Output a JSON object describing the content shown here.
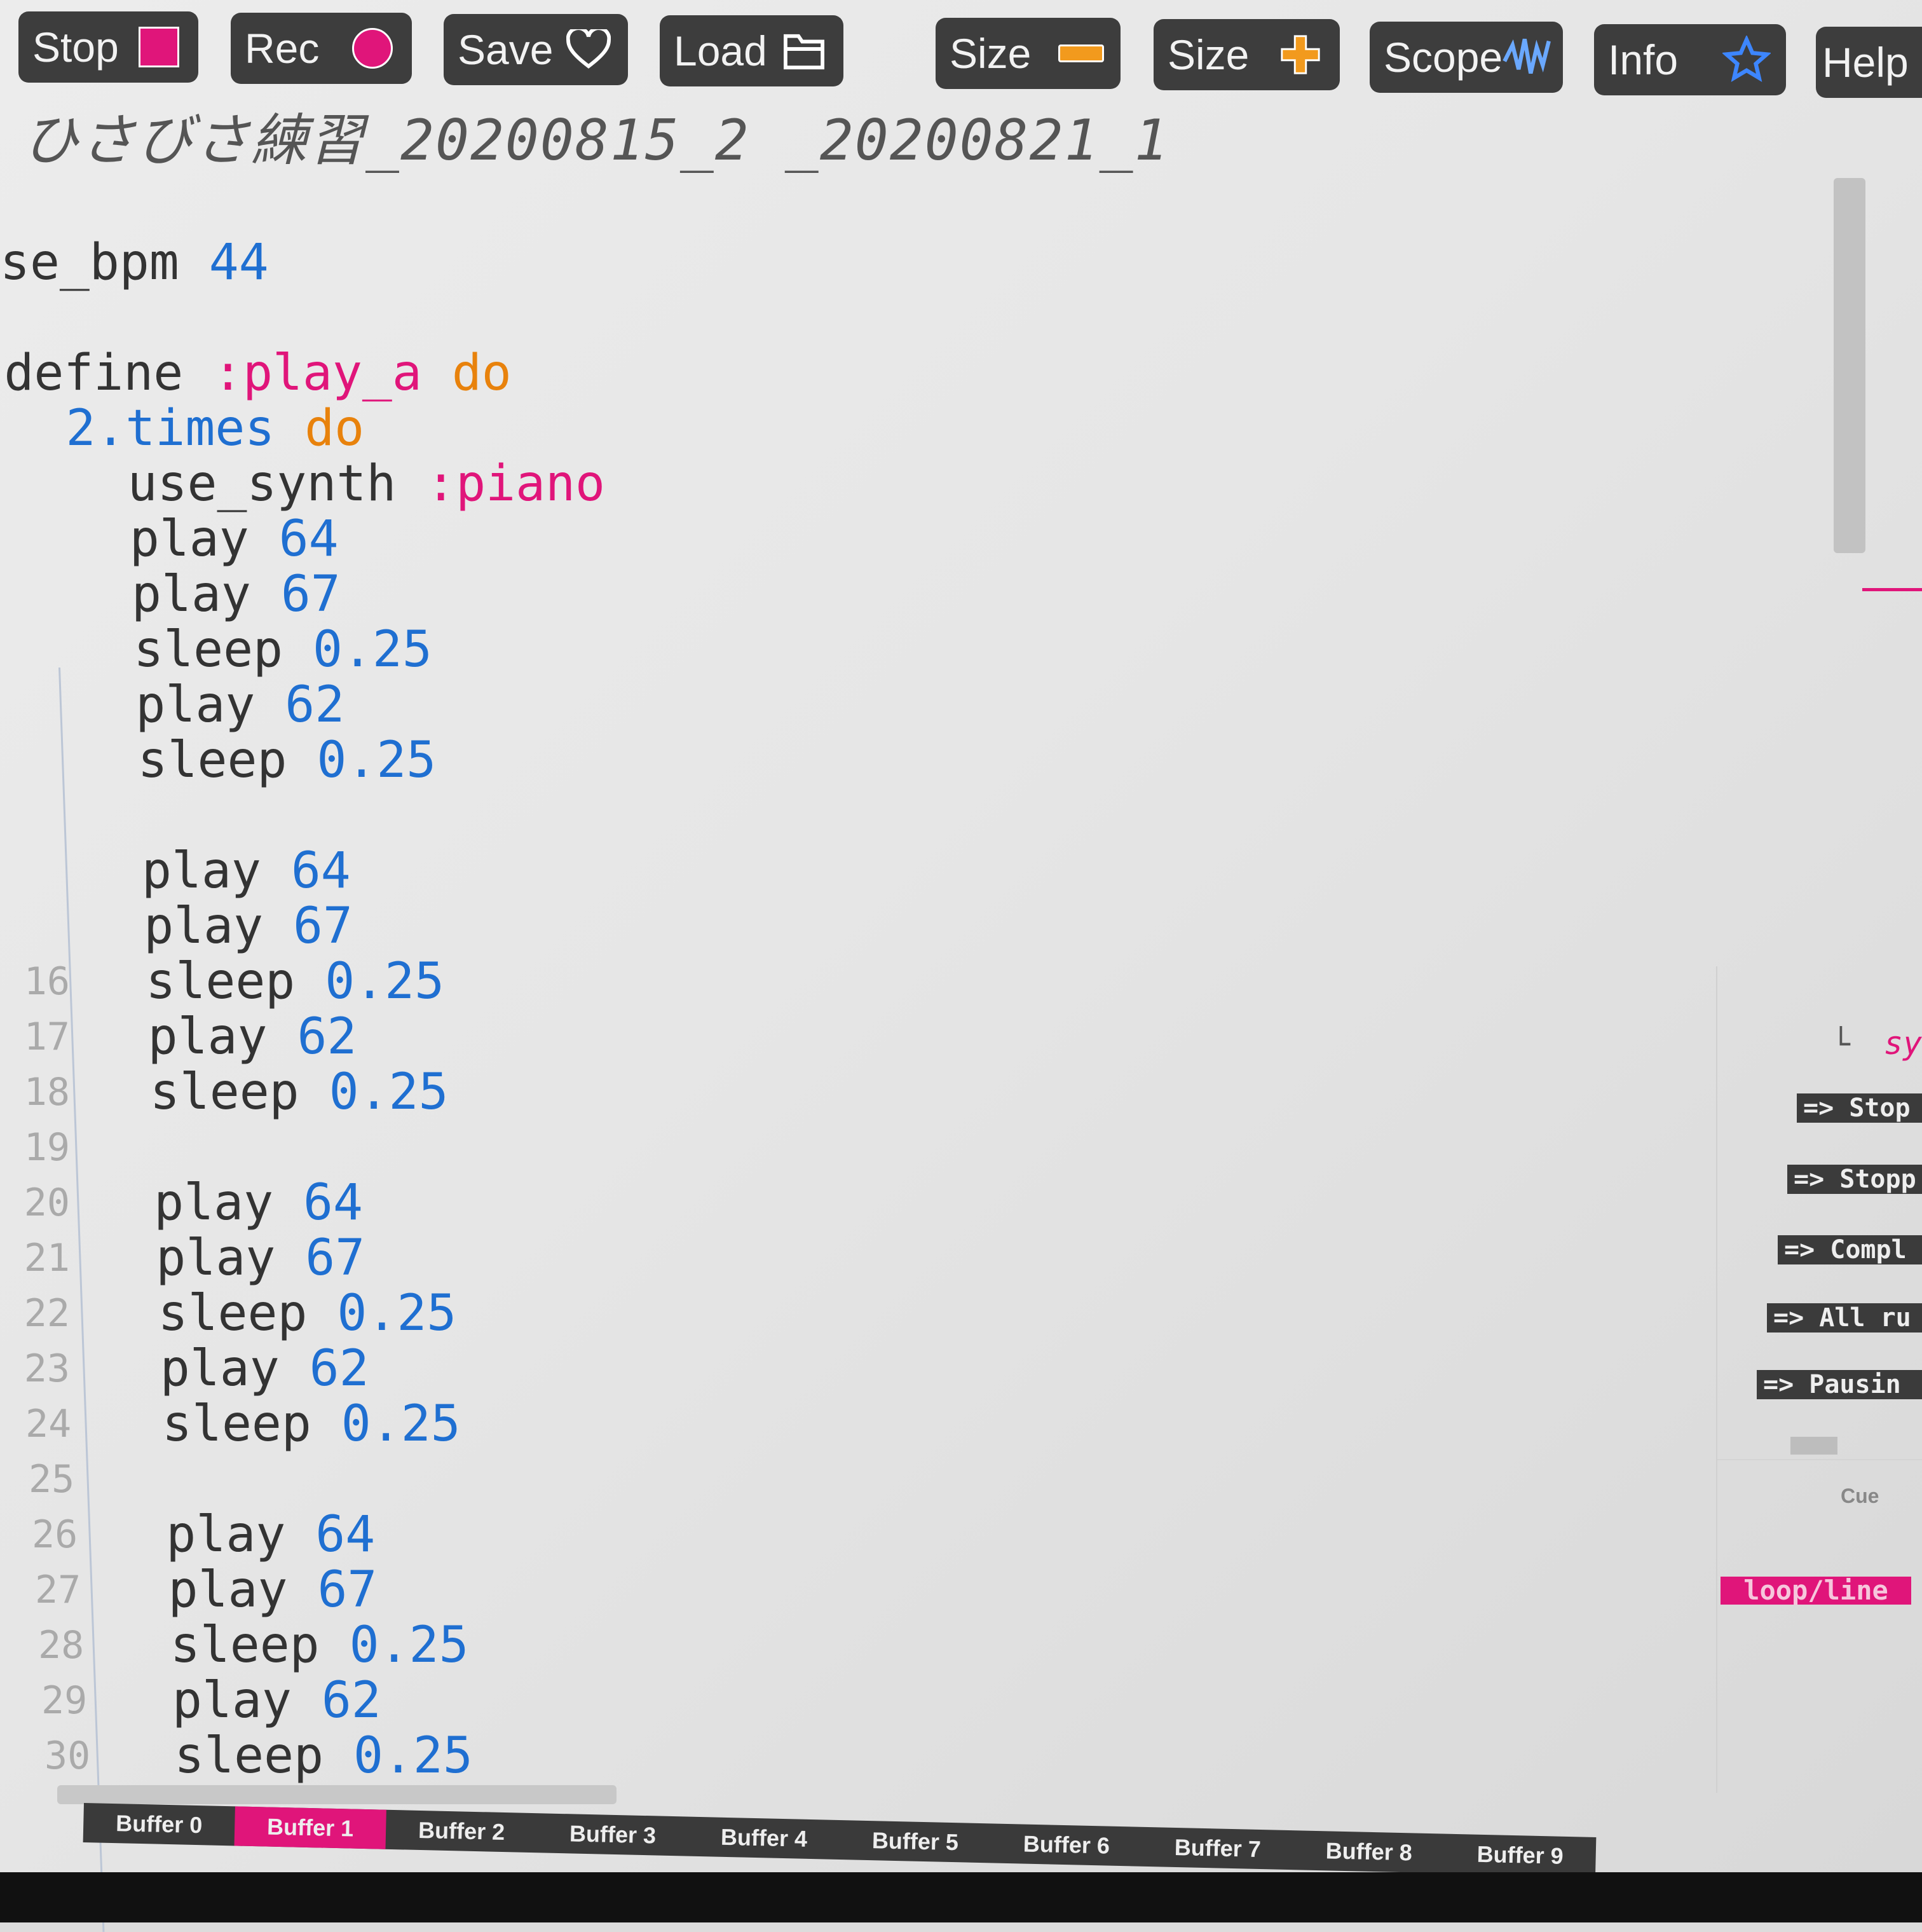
{
  "toolbar": {
    "buttons": [
      {
        "label": "Stop",
        "icon": "stop-square-icon"
      },
      {
        "label": "Rec",
        "icon": "record-circle-icon"
      },
      {
        "label": "Save",
        "icon": "heart-icon"
      },
      {
        "label": "Load",
        "icon": "folder-icon"
      },
      {
        "label": "Size",
        "icon": "minus-icon"
      },
      {
        "label": "Size",
        "icon": "plus-icon"
      },
      {
        "label": "Scope",
        "icon": "waveform-icon"
      },
      {
        "label": "Info",
        "icon": "star-icon"
      },
      {
        "label": "Help",
        "icon": ""
      }
    ]
  },
  "colors": {
    "accent": "#e0157a",
    "number": "#1f6fd1",
    "keyword": "#e8820c",
    "toolbar": "#3d3d3d",
    "plus_icon": "#f29a1d"
  },
  "editor": {
    "title": "ひさびさ練習_20200815_2 _20200821_1",
    "line_numbers": [
      "16",
      "17",
      "18",
      "19",
      "20",
      "21",
      "22",
      "23",
      "24",
      "25",
      "26",
      "27",
      "28",
      "29",
      "30"
    ],
    "lines": [
      [
        {
          "t": "se_bpm ",
          "c": "txt"
        },
        {
          "t": "44",
          "c": "num"
        }
      ],
      [],
      [
        {
          "t": "define ",
          "c": "txt"
        },
        {
          "t": ":play_a ",
          "c": "sym"
        },
        {
          "t": "do",
          "c": "kw"
        }
      ],
      [
        {
          "t": "  2.times ",
          "c": "num"
        },
        {
          "t": "do",
          "c": "kw"
        }
      ],
      [
        {
          "t": "    use_synth ",
          "c": "txt"
        },
        {
          "t": ":piano",
          "c": "sym"
        }
      ],
      [
        {
          "t": "    play ",
          "c": "txt"
        },
        {
          "t": "64",
          "c": "num"
        }
      ],
      [
        {
          "t": "    play ",
          "c": "txt"
        },
        {
          "t": "67",
          "c": "num"
        }
      ],
      [
        {
          "t": "    sleep ",
          "c": "txt"
        },
        {
          "t": "0.25",
          "c": "num"
        }
      ],
      [
        {
          "t": "    play ",
          "c": "txt"
        },
        {
          "t": "62",
          "c": "num"
        }
      ],
      [
        {
          "t": "    sleep ",
          "c": "txt"
        },
        {
          "t": "0.25",
          "c": "num"
        }
      ],
      [],
      [
        {
          "t": "    play ",
          "c": "txt"
        },
        {
          "t": "64",
          "c": "num"
        }
      ],
      [
        {
          "t": "    play ",
          "c": "txt"
        },
        {
          "t": "67",
          "c": "num"
        }
      ],
      [
        {
          "t": "    sleep ",
          "c": "txt"
        },
        {
          "t": "0.25",
          "c": "num"
        }
      ],
      [
        {
          "t": "    play ",
          "c": "txt"
        },
        {
          "t": "62",
          "c": "num"
        }
      ],
      [
        {
          "t": "    sleep ",
          "c": "txt"
        },
        {
          "t": "0.25",
          "c": "num"
        }
      ],
      [],
      [
        {
          "t": "    play ",
          "c": "txt"
        },
        {
          "t": "64",
          "c": "num"
        }
      ],
      [
        {
          "t": "    play ",
          "c": "txt"
        },
        {
          "t": "67",
          "c": "num"
        }
      ],
      [
        {
          "t": "    sleep ",
          "c": "txt"
        },
        {
          "t": "0.25",
          "c": "num"
        }
      ],
      [
        {
          "t": "    play ",
          "c": "txt"
        },
        {
          "t": "62",
          "c": "num"
        }
      ],
      [
        {
          "t": "    sleep ",
          "c": "txt"
        },
        {
          "t": "0.25",
          "c": "num"
        }
      ],
      [],
      [
        {
          "t": "    play ",
          "c": "txt"
        },
        {
          "t": "64",
          "c": "num"
        }
      ],
      [
        {
          "t": "    play ",
          "c": "txt"
        },
        {
          "t": "67",
          "c": "num"
        }
      ],
      [
        {
          "t": "    sleep ",
          "c": "txt"
        },
        {
          "t": "0.25",
          "c": "num"
        }
      ],
      [
        {
          "t": "    play ",
          "c": "txt"
        },
        {
          "t": "62",
          "c": "num"
        }
      ],
      [
        {
          "t": "    sleep ",
          "c": "txt"
        },
        {
          "t": "0.25",
          "c": "num"
        }
      ]
    ]
  },
  "buffers": {
    "active": 1,
    "tabs": [
      "Buffer 0",
      "Buffer 1",
      "Buffer 2",
      "Buffer 3",
      "Buffer 4",
      "Buffer 5",
      "Buffer 6",
      "Buffer 7",
      "Buffer 8",
      "Buffer 9"
    ]
  },
  "log": {
    "tree_prefix": "└",
    "synth_text": "sy",
    "entries": [
      "=> Stop",
      "=> Stopp",
      "=> Compl",
      "=> All ru",
      "=> Pausin"
    ],
    "cue_label": "Cue",
    "cue_badge": "loop/line"
  }
}
